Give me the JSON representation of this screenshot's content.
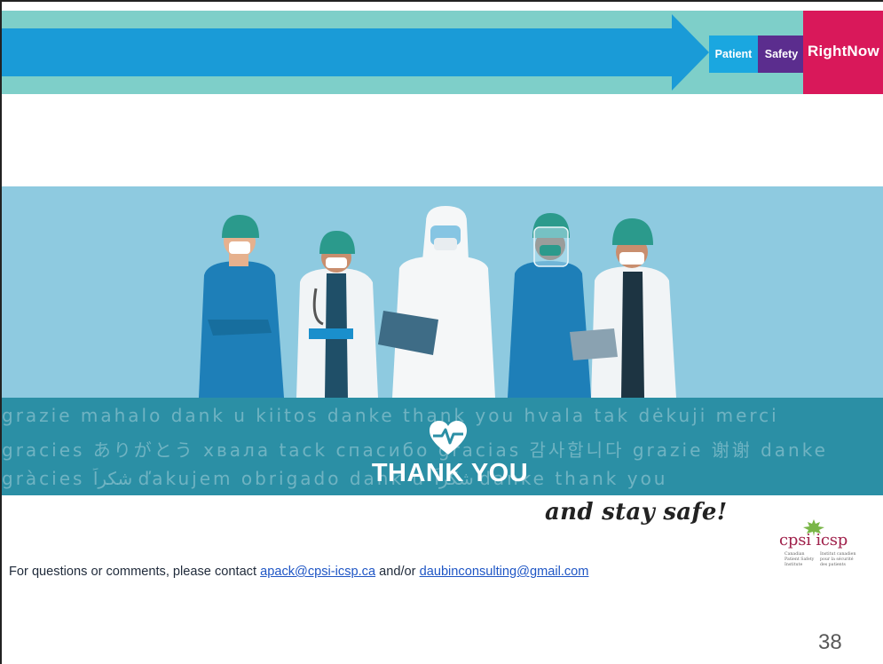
{
  "header": {
    "logo_patient": "Patient",
    "logo_safety": "Safety",
    "logo_right_now": "RightNow",
    "colors": {
      "banner": "#7ecfc9",
      "arrow": "#1a9bd7",
      "patient": "#1aa7e0",
      "safety": "#5b2d8e",
      "right_now": "#d9185a"
    }
  },
  "hero": {
    "multilingual_row_1": "grazie mahalo dank u kiitos danke thank you hvala tak dėkuji merci",
    "multilingual_row_2": "gracies ありがとう хвала tack спасибо gracias 감사합니다 grazie 谢谢 danke",
    "multilingual_row_3": "gràcies شكراً ďakujem obrigado dank u شكراً danke thank you",
    "thank_you": "THANK YOU",
    "heart_icon": "heart-pulse-icon"
  },
  "tagline": "and stay safe!",
  "footer": {
    "contact_prefix": "For questions or comments, please contact ",
    "email_1": "apack@cpsi-icsp.ca",
    "contact_middle": " and/or ",
    "email_2": "daubinconsulting@gmail.com"
  },
  "cpsi_logo": {
    "name": "cpsi icsp",
    "english": "Canadian Patient Safety Institute",
    "french": "Institut canadien pour la sécurité des patients"
  },
  "page_number": "38"
}
